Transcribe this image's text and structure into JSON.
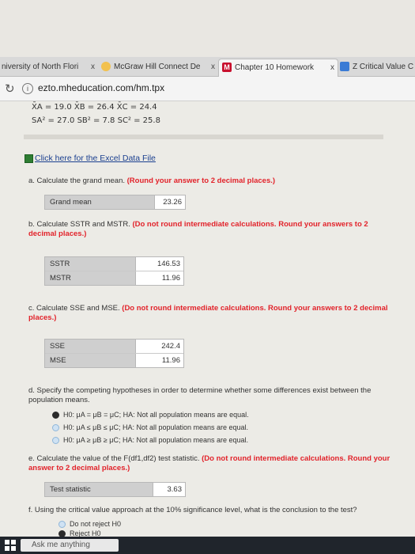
{
  "tabs": [
    {
      "label": "niversity of North Flori",
      "close": "x"
    },
    {
      "label": "McGraw Hill Connect De",
      "close": "x"
    },
    {
      "label": "Chapter 10 Homework",
      "close": "x"
    },
    {
      "label": "Z Critical Value C",
      "close": ""
    }
  ],
  "address": {
    "url": "ezto.mheducation.com/hm.tpx"
  },
  "stats": {
    "line1": "X̄A = 19.0   X̄B = 26.4   X̄C = 24.4",
    "line2": "SA² = 27.0   SB² = 7.8   SC² = 25.8"
  },
  "excel_link": "Click here for the Excel Data File",
  "qa": {
    "prompt": "a. Calculate the grand mean.",
    "note": "(Round your answer to 2 decimal places.)",
    "label": "Grand mean",
    "value": "23.26"
  },
  "qb": {
    "prompt": "b. Calculate SSTR and MSTR.",
    "note": "(Do not round intermediate calculations. Round your answers to 2 decimal places.)",
    "rows": [
      {
        "label": "SSTR",
        "value": "146.53"
      },
      {
        "label": "MSTR",
        "value": "11.96"
      }
    ]
  },
  "qc": {
    "prompt": "c. Calculate SSE and MSE.",
    "note": "(Do not round intermediate calculations. Round your answers to 2 decimal places.)",
    "rows": [
      {
        "label": "SSE",
        "value": "242.4"
      },
      {
        "label": "MSE",
        "value": "11.96"
      }
    ]
  },
  "qd": {
    "prompt": "d. Specify the competing hypotheses in order to determine whether some differences exist between the population means.",
    "options": [
      {
        "text": "H0: μA = μB = μC; HA: Not all population means are equal.",
        "selected": true
      },
      {
        "text": "H0: μA ≤ μB ≤ μC; HA: Not all population means are equal.",
        "selected": false
      },
      {
        "text": "H0: μA ≥ μB ≥ μC; HA: Not all population means are equal.",
        "selected": false
      }
    ]
  },
  "qe": {
    "prompt": "e. Calculate the value of the F(df1,df2) test statistic.",
    "note": "(Do not round intermediate calculations. Round your answer to 2 decimal places.)",
    "label": "Test statistic",
    "value": "3.63"
  },
  "qf": {
    "prompt": "f. Using the critical value approach at the 10% significance level, what is the conclusion to the test?",
    "options": [
      {
        "text": "Do not reject H0",
        "selected": false
      },
      {
        "text": "Reject H0",
        "selected": true
      }
    ]
  },
  "taskbar": {
    "search": "Ask me anything"
  }
}
